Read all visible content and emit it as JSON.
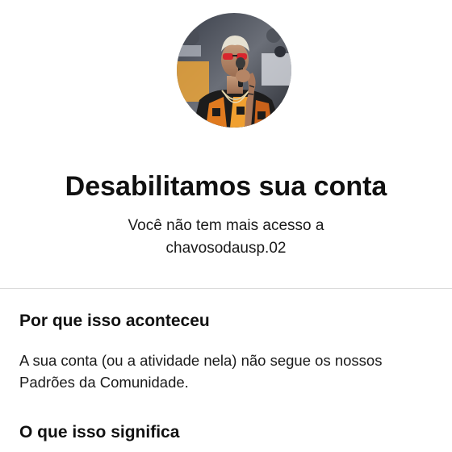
{
  "profile": {
    "avatar_icon": "profile-photo",
    "username": "chavosodausp.02"
  },
  "header": {
    "title": "Desabilitamos sua conta",
    "subtitle_line1": "Você não tem mais acesso a",
    "subtitle_line2": "chavosodausp.02"
  },
  "reason": {
    "heading": "Por que isso aconteceu",
    "body_line1": "A sua conta (ou a atividade nela) não segue os nossos",
    "body_line2": "Padrões da Comunidade."
  },
  "meaning": {
    "heading": "O que isso significa"
  },
  "colors": {
    "background": "#ffffff",
    "text": "#111111",
    "divider": "#dbdbdb"
  }
}
